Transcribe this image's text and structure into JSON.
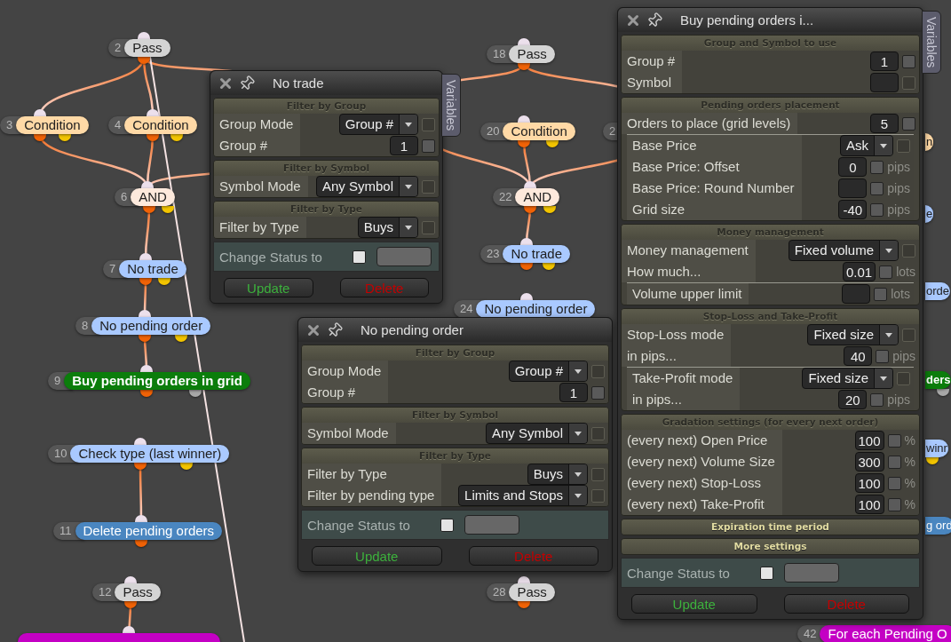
{
  "nodes": [
    {
      "number": "2",
      "label": "Pass",
      "color": "#d4d4d4"
    },
    {
      "number": "18",
      "label": "Pass",
      "color": "#d4d4d4"
    },
    {
      "number": "3",
      "label": "Condition",
      "color": "#ffd9a6"
    },
    {
      "number": "4",
      "label": "Condition",
      "color": "#ffd9a6"
    },
    {
      "number": "20",
      "label": "Condition",
      "color": "#ffd9a6"
    },
    {
      "number": "2"
    },
    {
      "label": "n",
      "color": "#ffd9a6"
    },
    {
      "number": "6",
      "label": "AND",
      "color": "#fde9dc"
    },
    {
      "number": "22",
      "label": "AND",
      "color": "#fde9dc"
    },
    {
      "label": "e",
      "color": "#a9c9ff"
    },
    {
      "number": "23",
      "label": "No trade",
      "color": "#a9c9ff"
    },
    {
      "number": "7",
      "label": "No trade",
      "color": "#a9c9ff"
    },
    {
      "label": "orde",
      "color": "#a9c9ff"
    },
    {
      "number": "24",
      "label": "No pending order",
      "color": "#a9c9ff"
    },
    {
      "number": "8",
      "label": "No pending order",
      "color": "#a9c9ff"
    },
    {
      "number": "9",
      "label": "Buy pending orders in grid",
      "color": "#0b7d0b"
    },
    {
      "label": "ders",
      "color": "#0b7d0b"
    },
    {
      "number": "10",
      "label": "Check type (last winner)",
      "color": "#a9c9ff"
    },
    {
      "label": "winr",
      "color": "#a9c9ff"
    },
    {
      "number": "11",
      "label": "Delete pending orders",
      "color": "#4a86c0"
    },
    {
      "label": "g ord",
      "color": "#4a86c0"
    },
    {
      "number": "12",
      "label": "Pass",
      "color": "#d4d4d4"
    },
    {
      "number": "28",
      "label": "Pass",
      "color": "#d4d4d4"
    },
    {
      "color": "#c400c4"
    },
    {
      "number": "42",
      "label": "For each Pending O",
      "color": "#c400c4"
    }
  ],
  "windows": [
    {
      "title": "No trade",
      "side_tab": "Variables",
      "sections": [
        {
          "heading": "Filter by Group",
          "expanded": true,
          "groups": [
            [
              {
                "label": "Group Mode",
                "control": {
                  "kind": "select",
                  "value": "Group #"
                },
                "checkbox": {
                  "checked": false,
                  "disabled": true
                }
              },
              {
                "label": "Group #",
                "control": {
                  "kind": "number",
                  "value": "1"
                },
                "checkbox": {
                  "checked": false,
                  "disabled": false
                }
              }
            ]
          ]
        },
        {
          "heading": "Filter by Symbol",
          "expanded": true,
          "groups": [
            [
              {
                "label": "Symbol Mode",
                "control": {
                  "kind": "select",
                  "value": "Any Symbol"
                },
                "checkbox": {
                  "checked": false,
                  "disabled": true
                }
              }
            ]
          ]
        },
        {
          "heading": "Filter by Type",
          "expanded": true,
          "groups": [
            [
              {
                "label": "Filter by Type",
                "control": {
                  "kind": "select",
                  "value": "Buys"
                },
                "checkbox": {
                  "checked": false,
                  "disabled": true
                }
              }
            ]
          ]
        }
      ],
      "change_status": {
        "label": "Change Status to",
        "checked": false
      },
      "buttons": [
        {
          "label": "Update",
          "kind": "update"
        },
        {
          "label": "Delete",
          "kind": "delete"
        }
      ]
    },
    {
      "title": "No pending order",
      "sections": [
        {
          "heading": "Filter by Group",
          "expanded": true,
          "groups": [
            [
              {
                "label": "Group Mode",
                "control": {
                  "kind": "select",
                  "value": "Group #"
                },
                "checkbox": {
                  "checked": false,
                  "disabled": true
                }
              },
              {
                "label": "Group #",
                "control": {
                  "kind": "number",
                  "value": "1"
                },
                "checkbox": {
                  "checked": false,
                  "disabled": false
                }
              }
            ]
          ]
        },
        {
          "heading": "Filter by Symbol",
          "expanded": true,
          "groups": [
            [
              {
                "label": "Symbol Mode",
                "control": {
                  "kind": "select",
                  "value": "Any Symbol"
                },
                "checkbox": {
                  "checked": false,
                  "disabled": true
                }
              }
            ]
          ]
        },
        {
          "heading": "Filter by Type",
          "expanded": true,
          "groups": [
            [
              {
                "label": "Filter by Type",
                "control": {
                  "kind": "select",
                  "value": "Buys"
                },
                "checkbox": {
                  "checked": false,
                  "disabled": true
                }
              },
              {
                "label": "Filter by pending type",
                "control": {
                  "kind": "select",
                  "value": "Limits and Stops"
                },
                "checkbox": {
                  "checked": false,
                  "disabled": true
                }
              }
            ]
          ]
        }
      ],
      "change_status": {
        "label": "Change Status to",
        "checked": false
      },
      "buttons": [
        {
          "label": "Update",
          "kind": "update"
        },
        {
          "label": "Delete",
          "kind": "delete"
        }
      ]
    },
    {
      "title": "Buy pending orders i...",
      "side_tab": "Variables",
      "sections": [
        {
          "heading": "Group and Symbol to use",
          "expanded": true,
          "groups": [
            [
              {
                "label": "Group #",
                "control": {
                  "kind": "number",
                  "value": "1"
                },
                "checkbox": {
                  "checked": false,
                  "disabled": false
                }
              },
              {
                "label": "Symbol",
                "control": {
                  "kind": "number"
                },
                "checkbox": {
                  "checked": false,
                  "disabled": true
                }
              }
            ]
          ]
        },
        {
          "heading": "Pending orders placement",
          "expanded": true,
          "groups": [
            [
              {
                "label": "Orders to place (grid levels)",
                "control": {
                  "kind": "number",
                  "value": "5"
                },
                "checkbox": {
                  "checked": false,
                  "disabled": false
                }
              }
            ],
            [
              {
                "label": "Base Price",
                "control": {
                  "kind": "select",
                  "value": "Ask"
                },
                "checkbox": {
                  "checked": false,
                  "disabled": true
                }
              },
              {
                "label": "Base Price: Offset",
                "control": {
                  "kind": "number",
                  "value": "0"
                },
                "checkbox": {
                  "checked": false,
                  "disabled": false
                },
                "unit": "pips"
              },
              {
                "label": "Base Price: Round Number",
                "control": {
                  "kind": "number"
                },
                "checkbox": {
                  "checked": false,
                  "disabled": false
                },
                "unit": "pips"
              },
              {
                "label": "Grid size",
                "control": {
                  "kind": "number",
                  "value": "-40"
                },
                "checkbox": {
                  "checked": false,
                  "disabled": false
                },
                "unit": "pips"
              }
            ]
          ]
        },
        {
          "heading": "Money management",
          "expanded": true,
          "groups": [
            [
              {
                "label": "Money management",
                "control": {
                  "kind": "select",
                  "value": "Fixed volume"
                },
                "checkbox": {
                  "checked": false,
                  "disabled": true
                }
              },
              {
                "label": "How much...",
                "control": {
                  "kind": "number",
                  "value": "0.01"
                },
                "checkbox": {
                  "checked": false,
                  "disabled": false
                },
                "unit": "lots"
              }
            ],
            [
              {
                "label": "Volume upper limit",
                "control": {
                  "kind": "number"
                },
                "checkbox": {
                  "checked": false,
                  "disabled": false
                },
                "unit": "lots"
              }
            ]
          ]
        },
        {
          "heading": "Stop-Loss and Take-Profit",
          "expanded": true,
          "groups": [
            [
              {
                "label": "Stop-Loss mode",
                "control": {
                  "kind": "select",
                  "value": "Fixed size"
                },
                "checkbox": {
                  "checked": false,
                  "disabled": true
                }
              },
              {
                "label": "in pips...",
                "control": {
                  "kind": "number",
                  "value": "40"
                },
                "checkbox": {
                  "checked": false,
                  "disabled": false
                },
                "unit": "pips"
              }
            ],
            [
              {
                "label": "Take-Profit mode",
                "control": {
                  "kind": "select",
                  "value": "Fixed size"
                },
                "checkbox": {
                  "checked": false,
                  "disabled": true
                }
              },
              {
                "label": "in pips...",
                "control": {
                  "kind": "number",
                  "value": "20"
                },
                "checkbox": {
                  "checked": false,
                  "disabled": false
                },
                "unit": "pips"
              }
            ]
          ]
        },
        {
          "heading": "Gradation settings (for every next order)",
          "expanded": true,
          "groups": [
            [
              {
                "label": "(every next) Open Price",
                "control": {
                  "kind": "number",
                  "value": "100"
                },
                "checkbox": {
                  "checked": false,
                  "disabled": false
                },
                "unit": "%"
              },
              {
                "label": "(every next) Volume Size",
                "control": {
                  "kind": "number",
                  "value": "300"
                },
                "checkbox": {
                  "checked": false,
                  "disabled": false
                },
                "unit": "%"
              },
              {
                "label": "(every next) Stop-Loss",
                "control": {
                  "kind": "number",
                  "value": "100"
                },
                "checkbox": {
                  "checked": false,
                  "disabled": false
                },
                "unit": "%"
              },
              {
                "label": "(every next) Take-Profit",
                "control": {
                  "kind": "number",
                  "value": "100"
                },
                "checkbox": {
                  "checked": false,
                  "disabled": false
                },
                "unit": "%"
              }
            ]
          ]
        },
        {
          "heading": "Expiration time period",
          "expanded": false
        },
        {
          "heading": "More settings",
          "expanded": false
        }
      ],
      "change_status": {
        "label": "Change Status to",
        "checked": false
      },
      "buttons": [
        {
          "label": "Update",
          "kind": "update"
        },
        {
          "label": "Delete",
          "kind": "delete"
        }
      ]
    }
  ]
}
